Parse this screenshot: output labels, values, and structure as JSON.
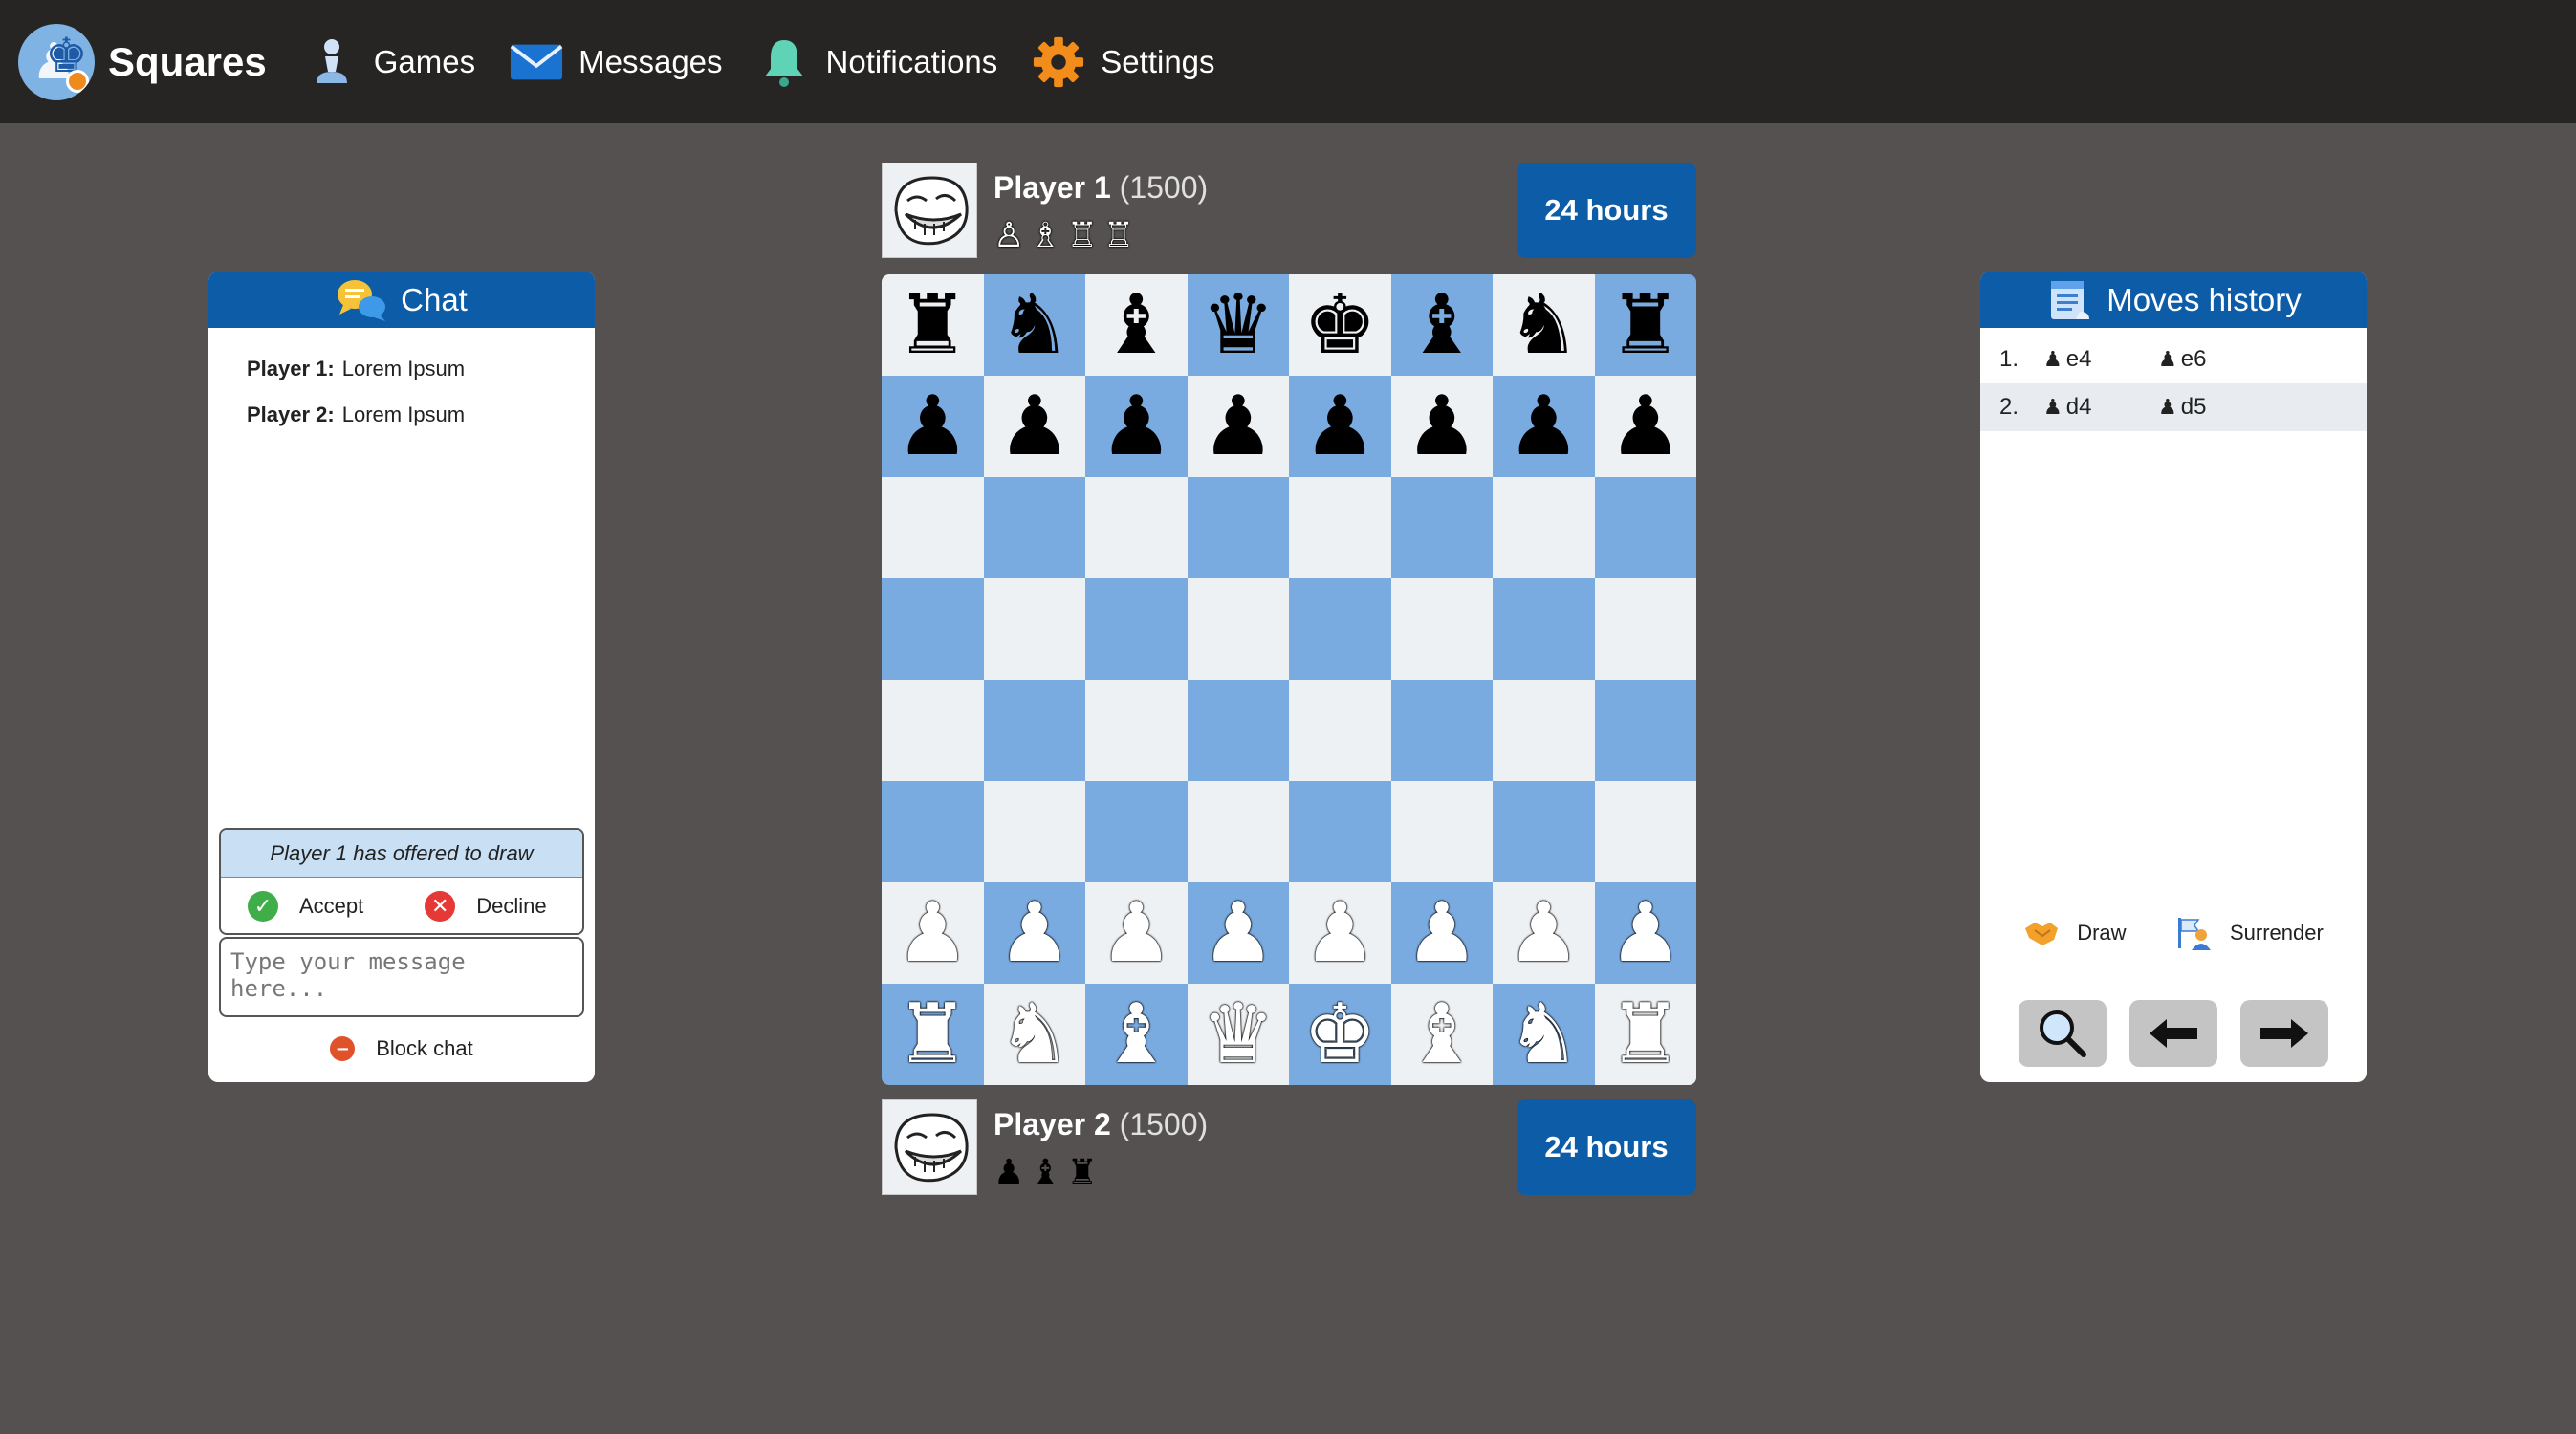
{
  "app": {
    "name": "Squares"
  },
  "nav": [
    {
      "label": "Games",
      "icon": "pawn-icon"
    },
    {
      "label": "Messages",
      "icon": "envelope-icon"
    },
    {
      "label": "Notifications",
      "icon": "bell-icon"
    },
    {
      "label": "Settings",
      "icon": "gear-icon"
    }
  ],
  "chat": {
    "title": "Chat",
    "messages": [
      {
        "sender": "Player 1:",
        "text": "Lorem Ipsum"
      },
      {
        "sender": "Player 2:",
        "text": "Lorem Ipsum"
      }
    ],
    "draw_offer": {
      "text": "Player 1 has offered to draw",
      "accept": "Accept",
      "decline": "Decline"
    },
    "input_placeholder": "Type your message here...",
    "block": "Block chat"
  },
  "player_top": {
    "name": "Player 1",
    "rating": "(1500)",
    "timer": "24 hours",
    "captured": [
      "♙",
      "♗",
      "♖",
      "♖"
    ]
  },
  "player_bottom": {
    "name": "Player 2",
    "rating": "(1500)",
    "timer": "24 hours",
    "captured": [
      "♟",
      "♝",
      "♜"
    ]
  },
  "board": [
    [
      "br",
      "bn",
      "bb",
      "bq",
      "bk",
      "bb",
      "bn",
      "br"
    ],
    [
      "bp",
      "bp",
      "bp",
      "bp",
      "bp",
      "bp",
      "bp",
      "bp"
    ],
    [
      "",
      "",
      "",
      "",
      "",
      "",
      "",
      ""
    ],
    [
      "",
      "",
      "",
      "",
      "",
      "",
      "",
      ""
    ],
    [
      "",
      "",
      "",
      "",
      "",
      "",
      "",
      ""
    ],
    [
      "",
      "",
      "",
      "",
      "",
      "",
      "",
      ""
    ],
    [
      "wp",
      "wp",
      "wp",
      "wp",
      "wp",
      "wp",
      "wp",
      "wp"
    ],
    [
      "wr",
      "wn",
      "wb",
      "wq",
      "wk",
      "wb",
      "wn",
      "wr"
    ]
  ],
  "moves": {
    "title": "Moves history",
    "rows": [
      {
        "num": "1.",
        "white": "e4",
        "black": "e6"
      },
      {
        "num": "2.",
        "white": "d4",
        "black": "d5"
      }
    ],
    "draw": "Draw",
    "surrender": "Surrender"
  },
  "colors": {
    "accent": "#0d5ca8",
    "topbar": "#272524",
    "background": "#545150",
    "light_square": "#eef1f4",
    "dark_square": "#7aabe0"
  }
}
